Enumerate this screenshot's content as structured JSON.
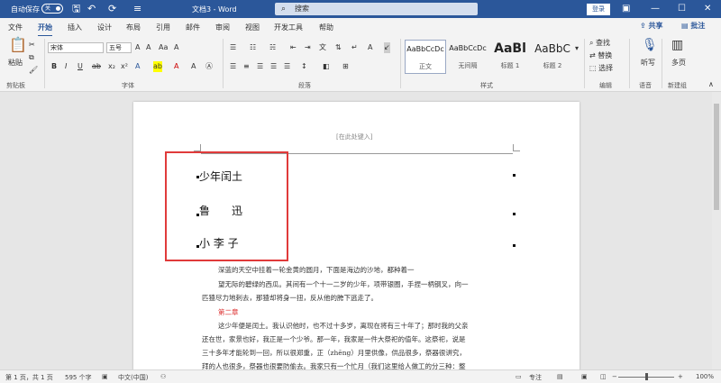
{
  "titlebar": {
    "autosave_label": "自动保存",
    "autosave_state": "关",
    "doc_title": "文档3 - Word",
    "search_placeholder": "搜索",
    "login_label": "登录"
  },
  "tabs": [
    "文件",
    "开始",
    "插入",
    "设计",
    "布局",
    "引用",
    "邮件",
    "审阅",
    "视图",
    "开发工具",
    "帮助"
  ],
  "share_label": "共享",
  "comment_label": "批注",
  "ribbon": {
    "clipboard": {
      "paste_label": "粘贴",
      "group_label": "剪贴板"
    },
    "font": {
      "font_name": "宋体",
      "font_size": "五号",
      "group_label": "字体",
      "bold": "B",
      "italic": "I",
      "underline": "U"
    },
    "paragraph": {
      "group_label": "段落"
    },
    "styles": {
      "group_label": "样式",
      "items": [
        {
          "sample": "AaBbCcDc",
          "name": "正文"
        },
        {
          "sample": "AaBbCcDc",
          "name": "无间隔"
        },
        {
          "sample": "AaBl",
          "name": "标题 1"
        },
        {
          "sample": "AaBbC",
          "name": "标题 2"
        }
      ]
    },
    "editing": {
      "find": "查找",
      "replace": "替换",
      "select": "选择",
      "group_label": "编辑"
    },
    "voice": {
      "dictate": "听写",
      "group_label": "语音"
    },
    "new_group": {
      "label": "多页",
      "group_label": "新建组"
    }
  },
  "document": {
    "header_placeholder": "[在此处键入]",
    "lines": [
      "少年闰土",
      "鲁　　迅",
      "小 李 子"
    ],
    "paragraphs": [
      {
        "text": "深蓝的天空中挂着一轮金黄的圆月，下面是海边的沙地，都种着一",
        "indent": true
      },
      {
        "text": "望无际的碧绿的西瓜。其间有一个十一二岁的少年，项带银圈，手捏一柄钢叉，向一",
        "indent": false
      },
      {
        "text": "匹猹尽力地刺去，那猹却将身一扭，反从他的胯下逃走了。",
        "indent": false
      },
      {
        "text": "第二章",
        "indent": true,
        "red": true
      },
      {
        "text": "这少年便是闰土。我认识他时，也不过十多岁，离现在将有三十年了；那时我的父亲",
        "indent": true
      },
      {
        "text": "还在世，家景也好，我正是一个少爷。那一年，我家是一件大祭祀的值年。这祭祀，说是",
        "indent": false
      },
      {
        "text": "三十多年才能轮到一回，所以很郑重，正（zhēng）月里供像，供品很多，祭器很讲究，",
        "indent": false
      },
      {
        "text": "拜的人也很多，祭器也很要防偷去。我家只有一个忙月（我们这里给人做工的分三种：整",
        "indent": false
      }
    ]
  },
  "statusbar": {
    "page": "第 1 页，共 1 页",
    "words": "595 个字",
    "language": "中文(中国)",
    "focus": "专注",
    "zoom": "100%"
  }
}
